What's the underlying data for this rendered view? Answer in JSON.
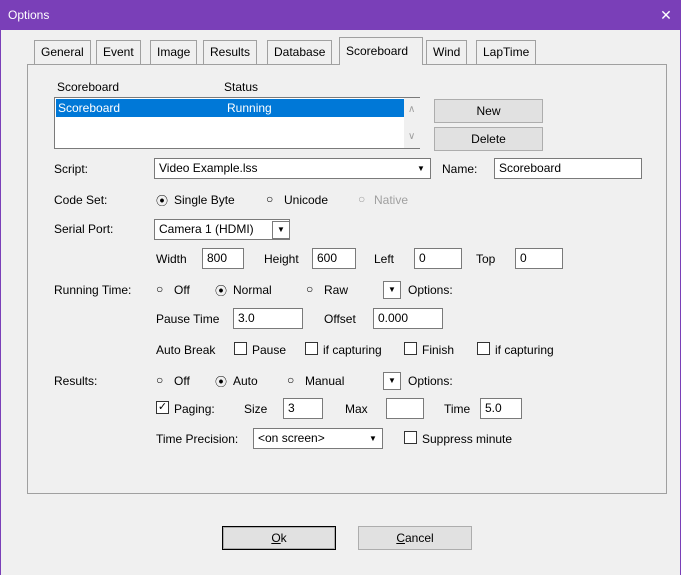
{
  "window": {
    "title": "Options",
    "close_glyph": "✕"
  },
  "tabs": [
    "General",
    "Event",
    "Image",
    "Results",
    "Database",
    "Scoreboard",
    "Wind",
    "LapTime"
  ],
  "active_tab": "Scoreboard",
  "list": {
    "headers": [
      "Scoreboard",
      "Status"
    ],
    "rows": [
      {
        "name": "Scoreboard",
        "status": "Running"
      }
    ],
    "buttons": {
      "new": "New",
      "delete": "Delete"
    }
  },
  "script": {
    "label": "Script:",
    "value": "Video Example.lss",
    "name_label": "Name:",
    "name_value": "Scoreboard"
  },
  "code_set": {
    "label": "Code Set:",
    "options": [
      "Single Byte",
      "Unicode",
      "Native"
    ],
    "selected": "Single Byte"
  },
  "serial_port": {
    "label": "Serial Port:",
    "value": "Camera 1 (HDMI)",
    "width_label": "Width",
    "width": "800",
    "height_label": "Height",
    "height": "600",
    "left_label": "Left",
    "left": "0",
    "top_label": "Top",
    "top": "0"
  },
  "running_time": {
    "label": "Running Time:",
    "options": [
      "Off",
      "Normal",
      "Raw"
    ],
    "selected": "Normal",
    "options_label": "Options:",
    "pause_label": "Pause Time",
    "pause": "3.0",
    "offset_label": "Offset",
    "offset": "0.000",
    "auto_break_label": "Auto Break",
    "auto_break_checks": [
      "Pause",
      "if capturing",
      "Finish",
      "if capturing"
    ]
  },
  "results": {
    "label": "Results:",
    "options": [
      "Off",
      "Auto",
      "Manual"
    ],
    "selected": "Auto",
    "options_label": "Options:",
    "paging_label": "Paging:",
    "paging_checked": true,
    "size_label": "Size",
    "size": "3",
    "max_label": "Max",
    "max": "",
    "time_label": "Time",
    "time": "5.0",
    "precision_label": "Time Precision:",
    "precision": "<on screen>",
    "suppress_label": "Suppress minute"
  },
  "footer": {
    "ok_mnemonic": "O",
    "ok_rest": "k",
    "cancel_mnemonic": "C",
    "cancel_rest": "ancel"
  },
  "glyphs": {
    "radio_on": "⦿",
    "radio_off": "○",
    "check": "✓",
    "down": "▼",
    "up": "∧",
    "down_small": "∨"
  },
  "colors": {
    "titlebar": "#7a3fb8",
    "selection": "#0078d7"
  }
}
